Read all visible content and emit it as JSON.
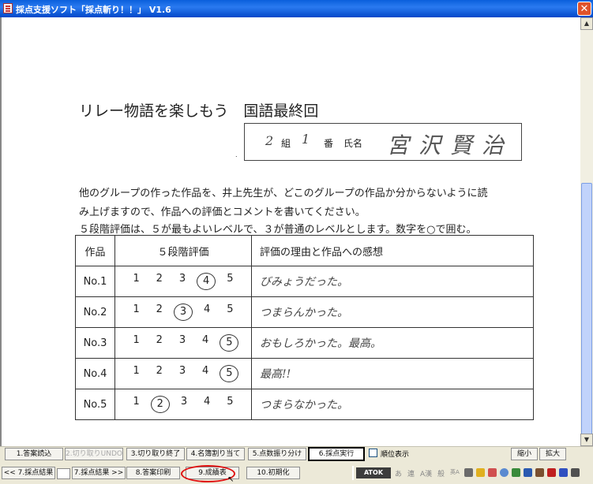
{
  "window": {
    "title": "採点支援ソフト「採点斬り！！」 V1.6",
    "close_glyph": "✕"
  },
  "document": {
    "title": "リレー物語を楽しもう　国語最終回",
    "name_box": {
      "dot": ".",
      "class_num": "2",
      "class_label": "組",
      "seat_num": "1",
      "seat_label": "番",
      "name_label": "氏名",
      "name_value": "宮沢賢治"
    },
    "instructions": [
      "他のグループの作った作品を、井上先生が、どこのグループの作品か分からないように読",
      "み上げますので、作品への評価とコメントを書いてください。",
      "５段階評価は、５が最もよいレベルで、３が普通のレベルとします。数字を○で囲む。"
    ],
    "table": {
      "headers": [
        "作品",
        "５段階評価",
        "評価の理由と作品への感想"
      ],
      "rows": [
        {
          "work": "No.1",
          "circled": 4,
          "comment": "びみょうだった。"
        },
        {
          "work": "No.2",
          "circled": 3,
          "comment": "つまらんかった。"
        },
        {
          "work": "No.3",
          "circled": 5,
          "comment": "おもしろかった。最高。"
        },
        {
          "work": "No.4",
          "circled": 5,
          "comment": "最高!!"
        },
        {
          "work": "No.5",
          "circled": 2,
          "comment": "つまらなかった。"
        }
      ]
    }
  },
  "toolbar": {
    "row1": [
      {
        "label": "1.答案読込",
        "enabled": true
      },
      {
        "label": "2.切り取りUNDO",
        "enabled": false
      },
      {
        "label": "3.切り取り終了",
        "enabled": true
      },
      {
        "label": "4.名簿割り当て",
        "enabled": true
      },
      {
        "label": "5.点数振り分け",
        "enabled": true
      },
      {
        "label": "6.採点実行",
        "enabled": true,
        "active": true
      }
    ],
    "rank_checkbox_label": "順位表示",
    "zoom_out": "縮小",
    "zoom_in": "拡大",
    "row2": [
      {
        "label": "<< 7.採点結果"
      },
      {
        "label": "7.採点結果 >>"
      },
      {
        "label": "8.答案印刷"
      },
      {
        "label": "9.成績表"
      },
      {
        "label": "10.初期化"
      }
    ]
  },
  "ime": {
    "name": "ATOK",
    "modes": [
      "あ",
      "連",
      "A漢",
      "般",
      "英A"
    ]
  },
  "colors": {
    "title_blue": "#0a5fdc",
    "highlight_ring": "#e01010"
  }
}
